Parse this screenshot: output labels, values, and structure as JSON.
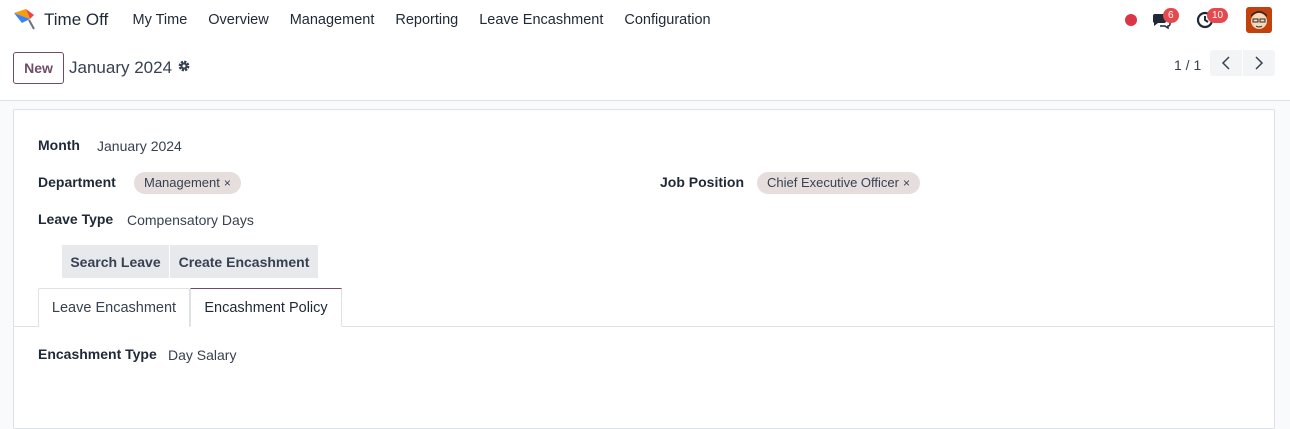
{
  "navbar": {
    "app_name": "Time Off",
    "menu": [
      "My Time",
      "Overview",
      "Management",
      "Reporting",
      "Leave Encashment",
      "Configuration"
    ],
    "chat_count": "6",
    "activity_count": "10",
    "colors": {
      "record_dot": "#dc3545",
      "badge": "#e5484d"
    }
  },
  "control": {
    "new_label": "New",
    "record_title": "January 2024",
    "pager_value": "1 / 1"
  },
  "form": {
    "month_label": "Month",
    "month_value": "January 2024",
    "department_label": "Department",
    "department_tag": "Management",
    "job_position_label": "Job Position",
    "job_position_tag": "Chief Executive Officer",
    "leave_type_label": "Leave Type",
    "leave_type_value": "Compensatory Days",
    "search_leave_label": "Search Leave",
    "create_encashment_label": "Create Encashment",
    "tabs": [
      "Leave Encashment",
      "Encashment Policy"
    ],
    "active_tab": "Encashment Policy",
    "encashment_type_label": "Encashment Type",
    "encashment_type_value": "Day Salary",
    "tag_remove_glyph": "×"
  },
  "accent_color": "#714b67"
}
